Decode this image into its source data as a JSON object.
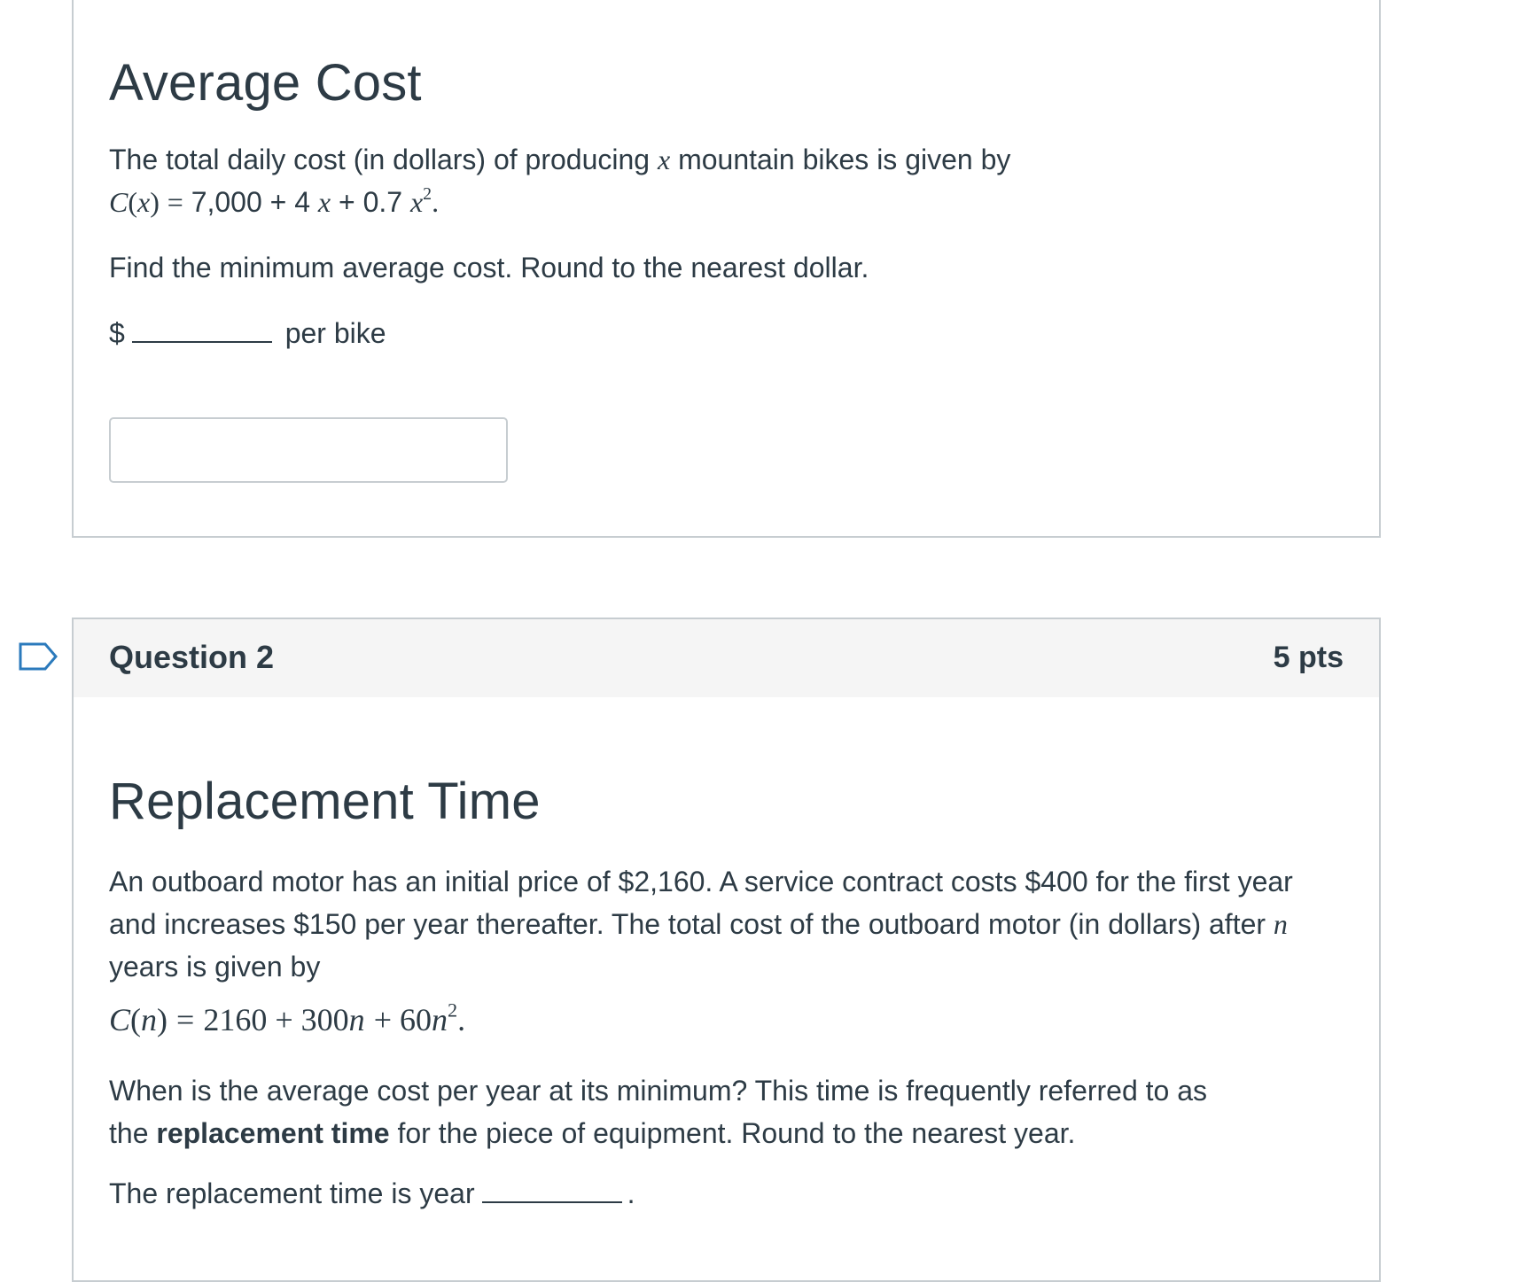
{
  "question1": {
    "title": "Average Cost",
    "intro_before_var": "The total daily cost (in dollars) of producing",
    "var_x": "x",
    "intro_after_var": "mountain bikes is given by",
    "formula": {
      "lhs_func": "C",
      "lhs_var": "x",
      "equals": "=",
      "part1": "7,000 + 4",
      "x1": "x",
      "part2": "+ 0.7",
      "x2": "x",
      "exponent": "2",
      "end": "."
    },
    "prompt": "Find the minimum average cost.  Round to the nearest dollar.",
    "currency_symbol": "$",
    "unit": "per bike",
    "answer_value": ""
  },
  "question2": {
    "name": "Question 2",
    "points": "5 pts",
    "title": "Replacement Time",
    "paragraph_line1": "An outboard motor has an initial price of $2,160. A service contract costs $400 for the first year",
    "paragraph_line2": "and increases $150 per year thereafter.  The total cost of the outboard motor (in dollars) after",
    "var_n": "n",
    "paragraph_line3": "years is given by",
    "formula": {
      "lhs_func": "C",
      "lhs_var": "n",
      "equals": "=",
      "c1": "2160 + 300",
      "n1": "n",
      "c2": "+ 60",
      "n2": "n",
      "exponent": "2",
      "end": "."
    },
    "question_line1": "When is the average cost per year at its minimum?  This time is frequently referred to as",
    "question_line2_before": "the",
    "question_line2_bold": "replacement time",
    "question_line2_after": "for the piece of equipment.  Round to the nearest year.",
    "answer_prefix": "The replacement time is year",
    "answer_suffix": "."
  },
  "icons": {
    "flag": "flag-question-icon"
  },
  "colors": {
    "text": "#2d3b45",
    "border": "#c7cdd1",
    "header_bg": "#f5f5f5",
    "flag_outline": "#2b7abc"
  }
}
